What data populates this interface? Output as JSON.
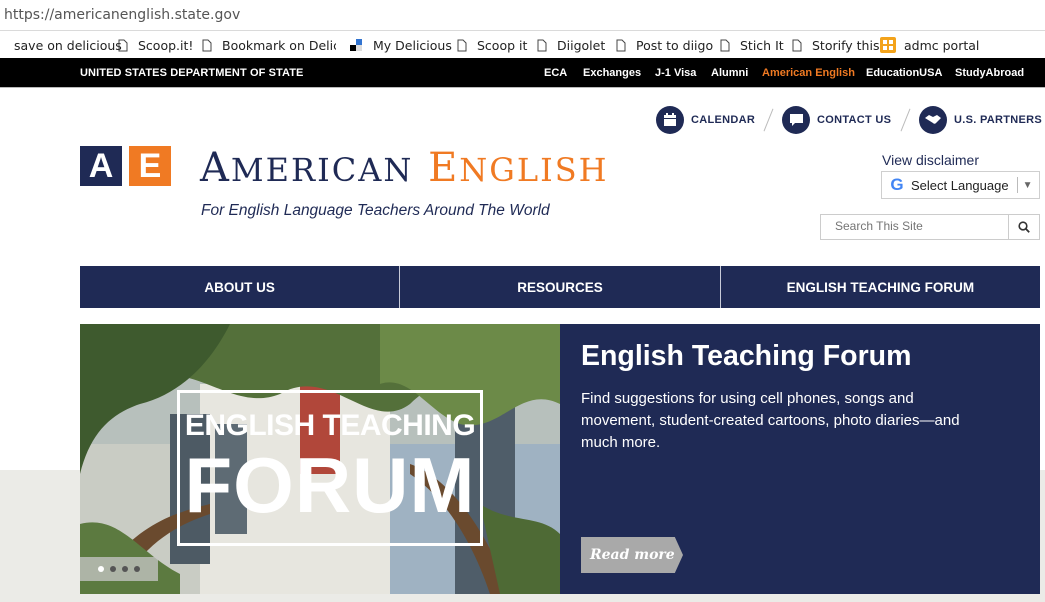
{
  "browser": {
    "url": "https://americanenglish.state.gov",
    "bookmarks": [
      "save on delicious",
      "Scoop.it!",
      "Bookmark on Delicio",
      "My Delicious",
      "Scoop it",
      "Diigolet",
      "Post to diigo",
      "Stich It",
      "Storify this",
      "admc portal"
    ]
  },
  "state_bar": {
    "title": "UNITED STATES DEPARTMENT OF STATE",
    "links": [
      "ECA",
      "Exchanges",
      "J-1 Visa",
      "Alumni",
      "American English",
      "EducationUSA",
      "StudyAbroad"
    ],
    "active_link": "American English",
    "active_color": "#f07a23"
  },
  "utility": {
    "calendar": "CALENDAR",
    "contact": "CONTACT US",
    "partners": "U.S. PARTNERS"
  },
  "logo": {
    "box_a": "A",
    "box_e": "E",
    "word1_first": "A",
    "word1_rest": "MERICAN",
    "word2_first": "E",
    "word2_rest": "NGLISH",
    "tagline": "For English Language Teachers Around The World"
  },
  "sidebar": {
    "disclaimer": "View disclaimer",
    "language_label": "Select Language",
    "search_placeholder": "Search This Site"
  },
  "nav": {
    "items": [
      "ABOUT US",
      "RESOURCES",
      "ENGLISH TEACHING FORUM"
    ]
  },
  "hero": {
    "image_line1": "ENGLISH TEACHING",
    "image_line2": "FORUM",
    "title": "English Teaching Forum",
    "description": "Find suggestions for using cell phones, songs and movement, student-created cartoons, photo diaries—and much more.",
    "read_more": "Read more",
    "slides": 4,
    "active_slide": 1
  },
  "colors": {
    "navy": "#1f2a55",
    "orange": "#f07a23"
  }
}
